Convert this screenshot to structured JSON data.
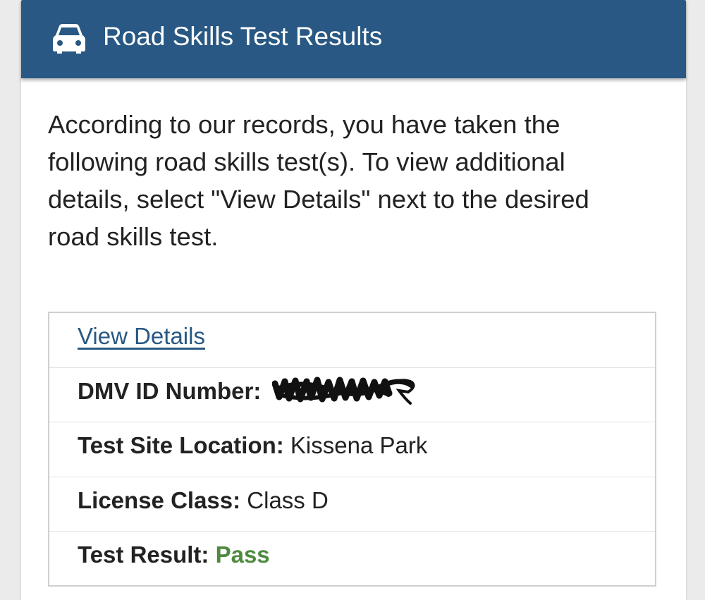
{
  "header": {
    "title": "Road Skills Test Results",
    "icon": "car-icon"
  },
  "intro_text": "According to our records, you have taken the following road skills test(s). To view additional details, select \"View Details\" next to the desired road skills test.",
  "test_record": {
    "view_details_link": "View Details",
    "dmv_id_label": "DMV ID Number:",
    "test_site_label": "Test Site Location:",
    "test_site_value": "Kissena Park",
    "license_class_label": "License Class:",
    "license_class_value": "Class D",
    "test_result_label": "Test Result:",
    "test_result_value": "Pass"
  },
  "colors": {
    "header_background": "#285883",
    "link": "#285883",
    "pass": "#4f8a3f"
  }
}
